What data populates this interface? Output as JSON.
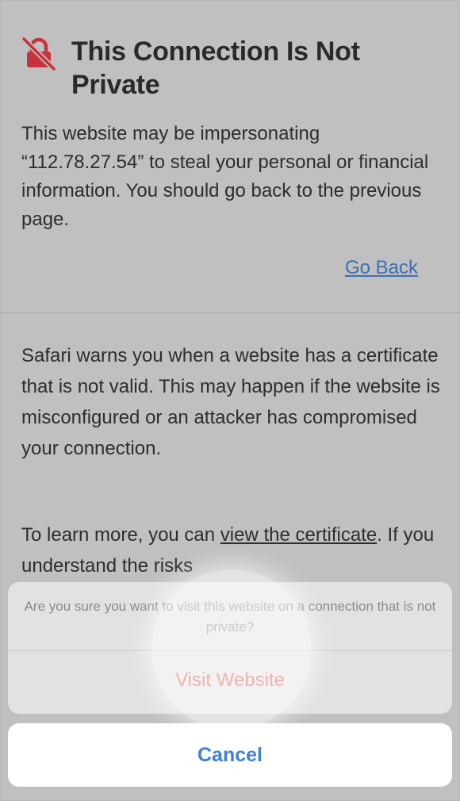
{
  "warning_page": {
    "title": "This Connection Is Not Private",
    "body": "This website may be impersonating “112.78.27.54” to steal your personal or financial information. You should go back to the previous page.",
    "go_back_label": "Go Back",
    "details": "Safari warns you when a website has a certificate that is not valid. This may happen if the website is misconfigured or an attacker has compromised your connection.",
    "learn_prefix": "To learn more, you can ",
    "learn_link": "view the certificate",
    "learn_suffix": ". If you understand the risks"
  },
  "action_sheet": {
    "message": "Are you sure you want to visit this website on a connection that is not private?",
    "visit_label": "Visit Website",
    "cancel_label": "Cancel"
  },
  "icons": {
    "warning": "no-lock-icon"
  },
  "colors": {
    "link": "#3d6fb3",
    "destructive": "#e5554a",
    "cancel": "#3f7fd9",
    "icon": "#c7333c"
  }
}
